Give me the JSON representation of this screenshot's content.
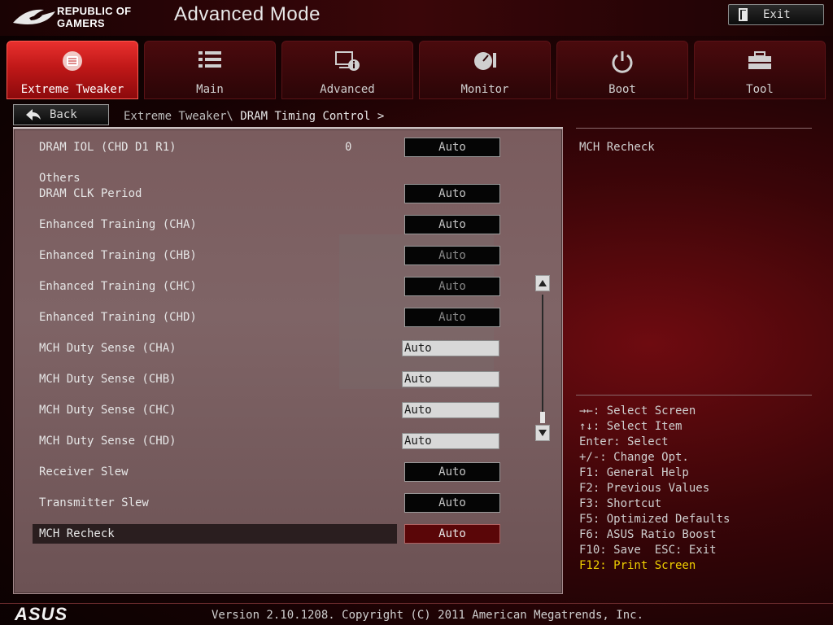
{
  "header": {
    "logo_line1": "REPUBLIC OF",
    "logo_line2": "GAMERS",
    "mode_title": "Advanced Mode",
    "exit_label": "Exit"
  },
  "tabs": [
    {
      "label": "Extreme Tweaker",
      "icon": "tweaker-icon",
      "active": true
    },
    {
      "label": "Main",
      "icon": "list-icon",
      "active": false
    },
    {
      "label": "Advanced",
      "icon": "advanced-icon",
      "active": false
    },
    {
      "label": "Monitor",
      "icon": "gauge-icon",
      "active": false
    },
    {
      "label": "Boot",
      "icon": "power-icon",
      "active": false
    },
    {
      "label": "Tool",
      "icon": "toolbox-icon",
      "active": false
    }
  ],
  "nav": {
    "back_label": "Back",
    "breadcrumb_parent": "Extreme Tweaker\\",
    "breadcrumb_current": "DRAM Timing Control >"
  },
  "settings": {
    "r0_label": "DRAM IOL (CHD D1 R1)",
    "r0_value": "0",
    "r0_option": "Auto",
    "section_others": "Others",
    "r1_label": "DRAM CLK Period",
    "r1_option": "Auto",
    "r2_label": "Enhanced Training (CHA)",
    "r2_option": "Auto",
    "r3_label": "Enhanced Training (CHB)",
    "r3_option": "Auto",
    "r4_label": "Enhanced Training (CHC)",
    "r4_option": "Auto",
    "r5_label": "Enhanced Training (CHD)",
    "r5_option": "Auto",
    "r6_label": "MCH Duty Sense (CHA)",
    "r6_value": "Auto",
    "r7_label": "MCH Duty Sense (CHB)",
    "r7_value": "Auto",
    "r8_label": "MCH Duty Sense (CHC)",
    "r8_value": "Auto",
    "r9_label": "MCH Duty Sense (CHD)",
    "r9_value": "Auto",
    "r10_label": "Receiver Slew",
    "r10_option": "Auto",
    "r11_label": "Transmitter Slew",
    "r11_option": "Auto",
    "r12_label": "MCH Recheck",
    "r12_option": "Auto"
  },
  "help": {
    "title": "MCH Recheck",
    "keys": [
      "→←: Select Screen",
      "↑↓: Select Item",
      "Enter: Select",
      "+/-: Change Opt.",
      "F1: General Help",
      "F2: Previous Values",
      "F3: Shortcut",
      "F5: Optimized Defaults",
      "F6: ASUS Ratio Boost",
      "F10: Save  ESC: Exit",
      "F12: Print Screen"
    ]
  },
  "footer": {
    "brand": "ASUS",
    "version": "Version 2.10.1208. Copyright (C) 2011 American Megatrends, Inc."
  },
  "colors": {
    "accent_red": "#c01818",
    "selected_option": "#5a0608",
    "highlight_key": "#f0d000"
  }
}
